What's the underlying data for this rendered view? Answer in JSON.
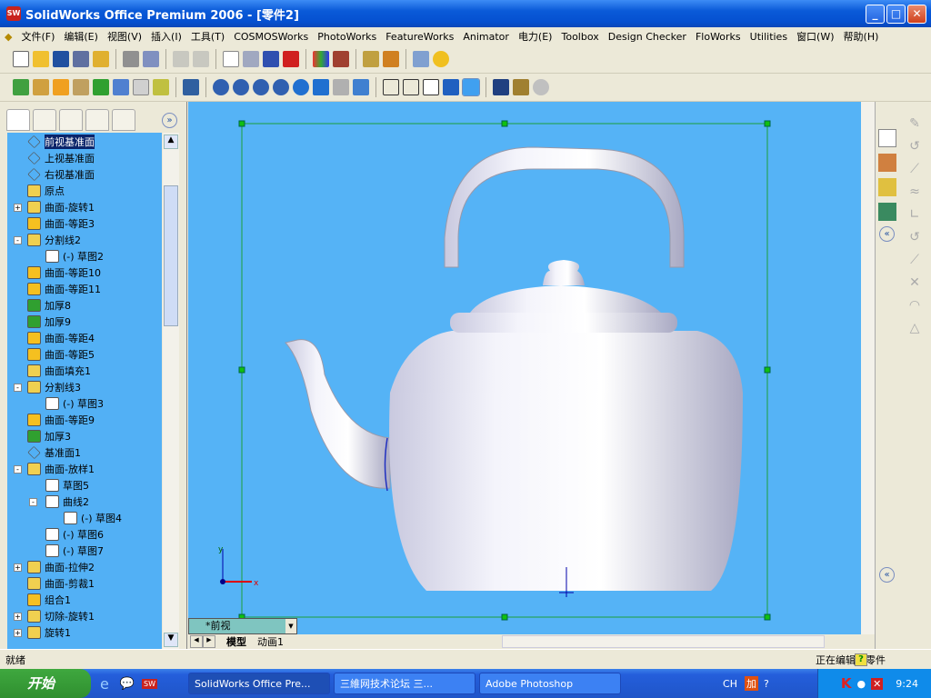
{
  "title": "SolidWorks Office Premium 2006 - [零件2]",
  "menu": [
    "文件(F)",
    "编辑(E)",
    "视图(V)",
    "插入(I)",
    "工具(T)",
    "COSMOSWorks",
    "PhotoWorks",
    "FeatureWorks",
    "Animator",
    "电力(E)",
    "Toolbox",
    "Design Checker",
    "FloWorks",
    "Utilities",
    "窗口(W)",
    "帮助(H)"
  ],
  "tree": [
    {
      "label": "前视基准面",
      "level": 0,
      "selected": true
    },
    {
      "label": "上视基准面",
      "level": 0
    },
    {
      "label": "右视基准面",
      "level": 0
    },
    {
      "label": "原点",
      "level": 0
    },
    {
      "label": "曲面-旋转1",
      "level": 0,
      "exp": "+"
    },
    {
      "label": "曲面-等距3",
      "level": 0
    },
    {
      "label": "分割线2",
      "level": 0,
      "exp": "-"
    },
    {
      "label": "(-) 草图2",
      "level": 1
    },
    {
      "label": "曲面-等距10",
      "level": 0
    },
    {
      "label": "曲面-等距11",
      "level": 0
    },
    {
      "label": "加厚8",
      "level": 0
    },
    {
      "label": "加厚9",
      "level": 0
    },
    {
      "label": "曲面-等距4",
      "level": 0
    },
    {
      "label": "曲面-等距5",
      "level": 0
    },
    {
      "label": "曲面填充1",
      "level": 0
    },
    {
      "label": "分割线3",
      "level": 0,
      "exp": "-"
    },
    {
      "label": "(-) 草图3",
      "level": 1
    },
    {
      "label": "曲面-等距9",
      "level": 0
    },
    {
      "label": "加厚3",
      "level": 0
    },
    {
      "label": "基准面1",
      "level": 0
    },
    {
      "label": "曲面-放样1",
      "level": 0,
      "exp": "-"
    },
    {
      "label": "草图5",
      "level": 1
    },
    {
      "label": "曲线2",
      "level": 1,
      "exp": "-"
    },
    {
      "label": "(-) 草图4",
      "level": 2
    },
    {
      "label": "(-) 草图6",
      "level": 1
    },
    {
      "label": "(-) 草图7",
      "level": 1
    },
    {
      "label": "曲面-拉伸2",
      "level": 0,
      "exp": "+"
    },
    {
      "label": "曲面-剪裁1",
      "level": 0
    },
    {
      "label": "组合1",
      "level": 0
    },
    {
      "label": "切除-旋转1",
      "level": 0,
      "exp": "+"
    },
    {
      "label": "旋转1",
      "level": 0,
      "exp": "+"
    }
  ],
  "viewport": {
    "view_name": "*前视",
    "background": "#55b3f6"
  },
  "bottom_tabs": [
    "模型",
    "动画1"
  ],
  "status": {
    "left": "就绪",
    "right": "正在编辑：零件"
  },
  "taskbar": {
    "start": "开始",
    "tasks": [
      "SolidWorks Office Pre...",
      "三維网技术论坛 三...",
      "Adobe Photoshop"
    ],
    "lang": "CH",
    "clock": "9:24"
  }
}
